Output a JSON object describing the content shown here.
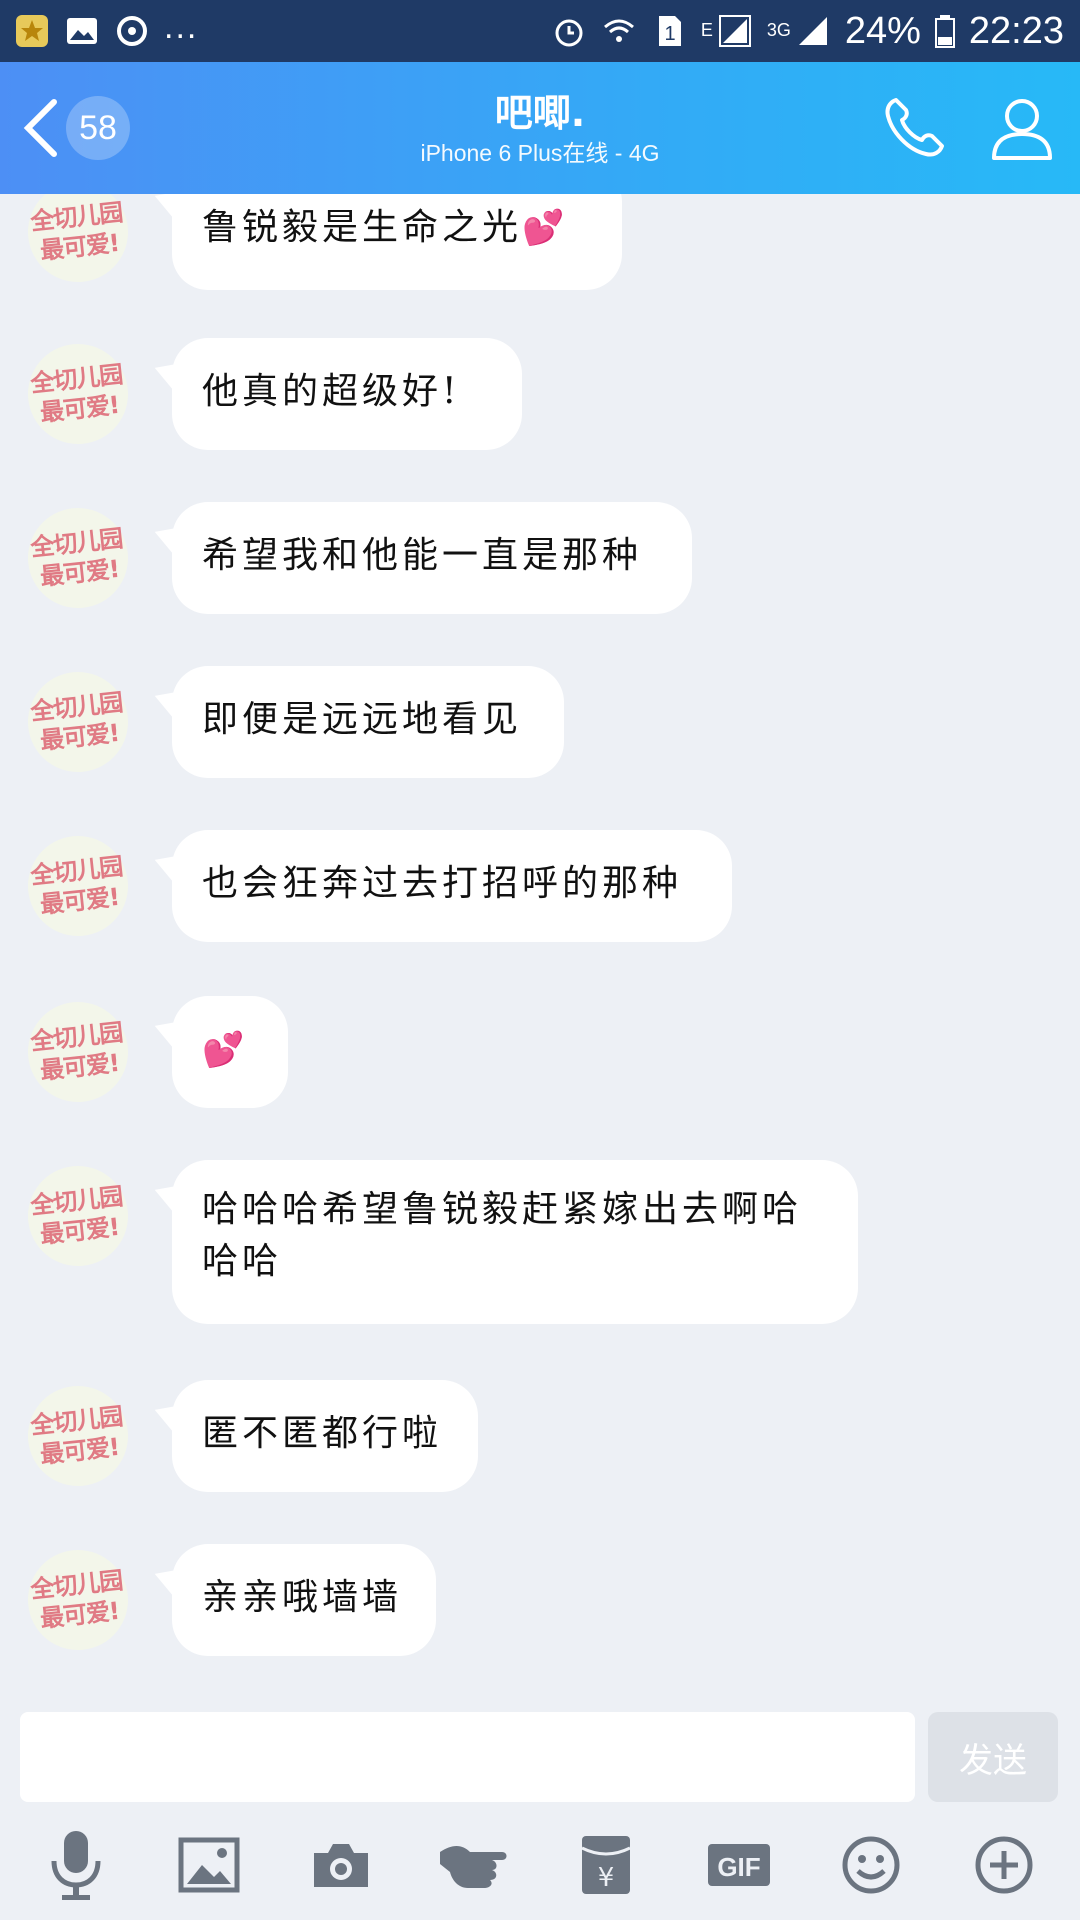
{
  "status_bar": {
    "more": "...",
    "signal_tag_e": "E",
    "signal_tag_3g": "3G",
    "battery": "24%",
    "time": "22:23",
    "sim_slot": "1"
  },
  "header": {
    "unread_count": "58",
    "contact_name": "吧唧.",
    "status": "iPhone 6 Plus在线 - 4G"
  },
  "avatar_text": {
    "line1": "全切儿园",
    "line2": "最可爱!"
  },
  "messages": [
    {
      "text": "鲁锐毅是生命之光",
      "heart": "💕"
    },
    {
      "text": "他真的超级好!"
    },
    {
      "text": "希望我和他能一直是那种"
    },
    {
      "text": "即便是远远地看见"
    },
    {
      "text": "也会狂奔过去打招呼的那种"
    },
    {
      "text": "",
      "heart": "💕"
    },
    {
      "text": "哈哈哈希望鲁锐毅赶紧嫁出去啊哈哈哈"
    },
    {
      "text": "匿不匿都行啦"
    },
    {
      "text": "亲亲哦墙墙"
    }
  ],
  "input": {
    "value": "",
    "send_label": "发送"
  },
  "toolbar": {
    "gif_label": "GIF",
    "icons": [
      "microphone-icon",
      "image-icon",
      "camera-icon",
      "poke-icon",
      "red-packet-icon",
      "gif-icon",
      "emoji-icon",
      "plus-icon"
    ]
  },
  "colors": {
    "header_start": "#4d8ff5",
    "header_end": "#27b9f7",
    "status_bar": "#1f3a66",
    "heart": "#f05aa6",
    "background": "#edf0f5"
  }
}
